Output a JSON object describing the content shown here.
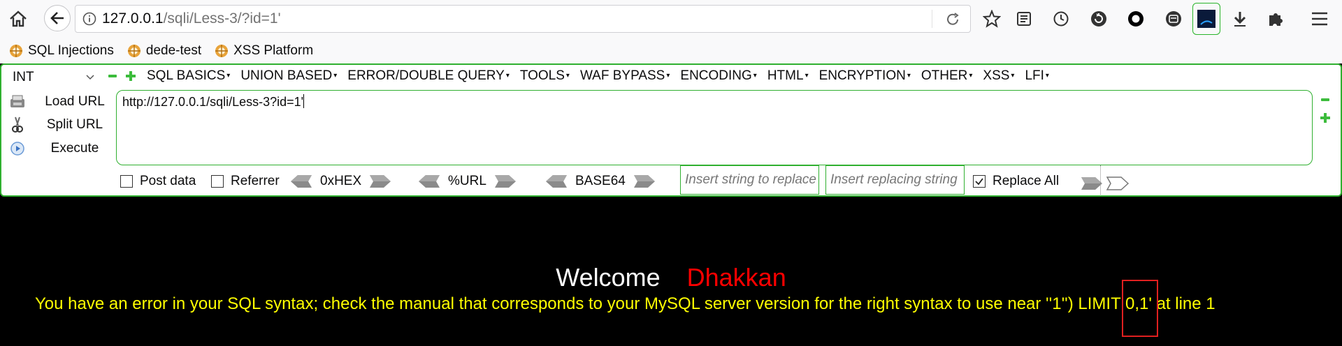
{
  "browser": {
    "url_host": "127.0.0.1",
    "url_path": "/sqli/Less-3/?id=1'",
    "toolbar_icons": [
      "bookmark-star-icon",
      "reading-list-icon",
      "history-icon",
      "sync-icon",
      "circle-icon",
      "screenshot-icon",
      "extension-active-icon",
      "download-icon",
      "puzzle-icon",
      "menu-icon"
    ]
  },
  "bookmarks": [
    {
      "label": "SQL Injections"
    },
    {
      "label": "dede-test"
    },
    {
      "label": "XSS Platform"
    }
  ],
  "hackbar": {
    "type_select": "INT",
    "menus": [
      "SQL BASICS",
      "UNION BASED",
      "ERROR/DOUBLE QUERY",
      "TOOLS",
      "WAF BYPASS",
      "ENCODING",
      "HTML",
      "ENCRYPTION",
      "OTHER",
      "XSS",
      "LFI"
    ],
    "actions": {
      "load_url": "Load URL",
      "split_url": "Split URL",
      "execute": "Execute"
    },
    "url_value": "http://127.0.0.1/sqli/Less-3?id=1'",
    "post_data": "Post data",
    "referrer": "Referrer",
    "hex": "0xHEX",
    "url_enc": "%URL",
    "base64": "BASE64",
    "replace_placeholder": "Insert string to replace",
    "replacing_placeholder": "Insert replacing string",
    "replace_all": "Replace All",
    "replace_all_checked": true
  },
  "page": {
    "welcome": "Welcome",
    "name": "Dhakkan",
    "error": "You have an error in your SQL syntax; check the manual that corresponds to your MySQL server version for the right syntax to use near ''1'') LIMIT 0,1' at line 1",
    "colors": {
      "welcome": "#ffffff",
      "name": "#ff0000",
      "error": "#ffff00",
      "highlight": "#e02020"
    }
  }
}
